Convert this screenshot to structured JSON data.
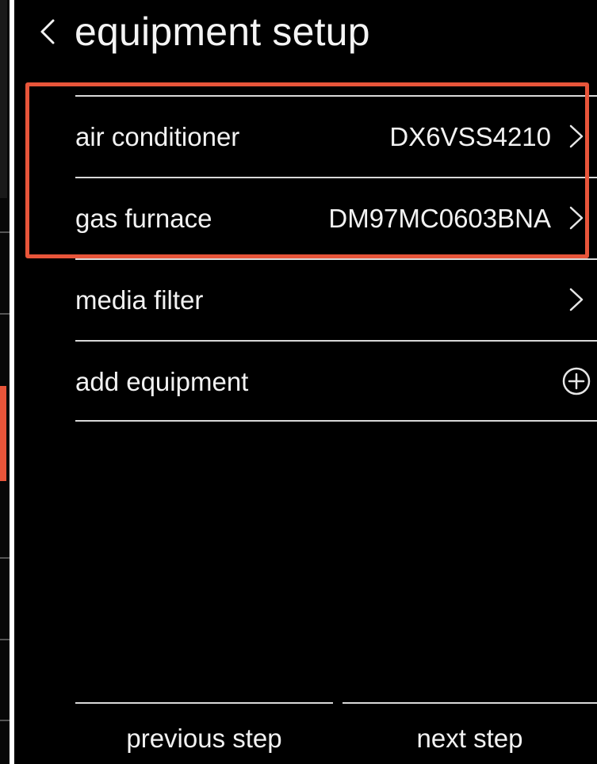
{
  "header": {
    "back_icon": "chevron-left-icon",
    "title": "equipment setup"
  },
  "equipment": {
    "items": [
      {
        "label": "air conditioner",
        "value": "DX6VSS4210",
        "icon": "chevron-right-icon",
        "highlighted": true
      },
      {
        "label": "gas furnace",
        "value": "DM97MC0603BNA",
        "icon": "chevron-right-icon",
        "highlighted": true
      },
      {
        "label": "media filter",
        "value": "",
        "icon": "chevron-right-icon",
        "highlighted": false
      },
      {
        "label": "add equipment",
        "value": "",
        "icon": "plus-circle-icon",
        "highlighted": false
      }
    ]
  },
  "footer": {
    "previous_label": "previous step",
    "next_label": "next step"
  },
  "colors": {
    "background": "#000000",
    "text": "#f2f2f2",
    "divider": "#d9d9d9",
    "highlight": "#e8553a"
  }
}
